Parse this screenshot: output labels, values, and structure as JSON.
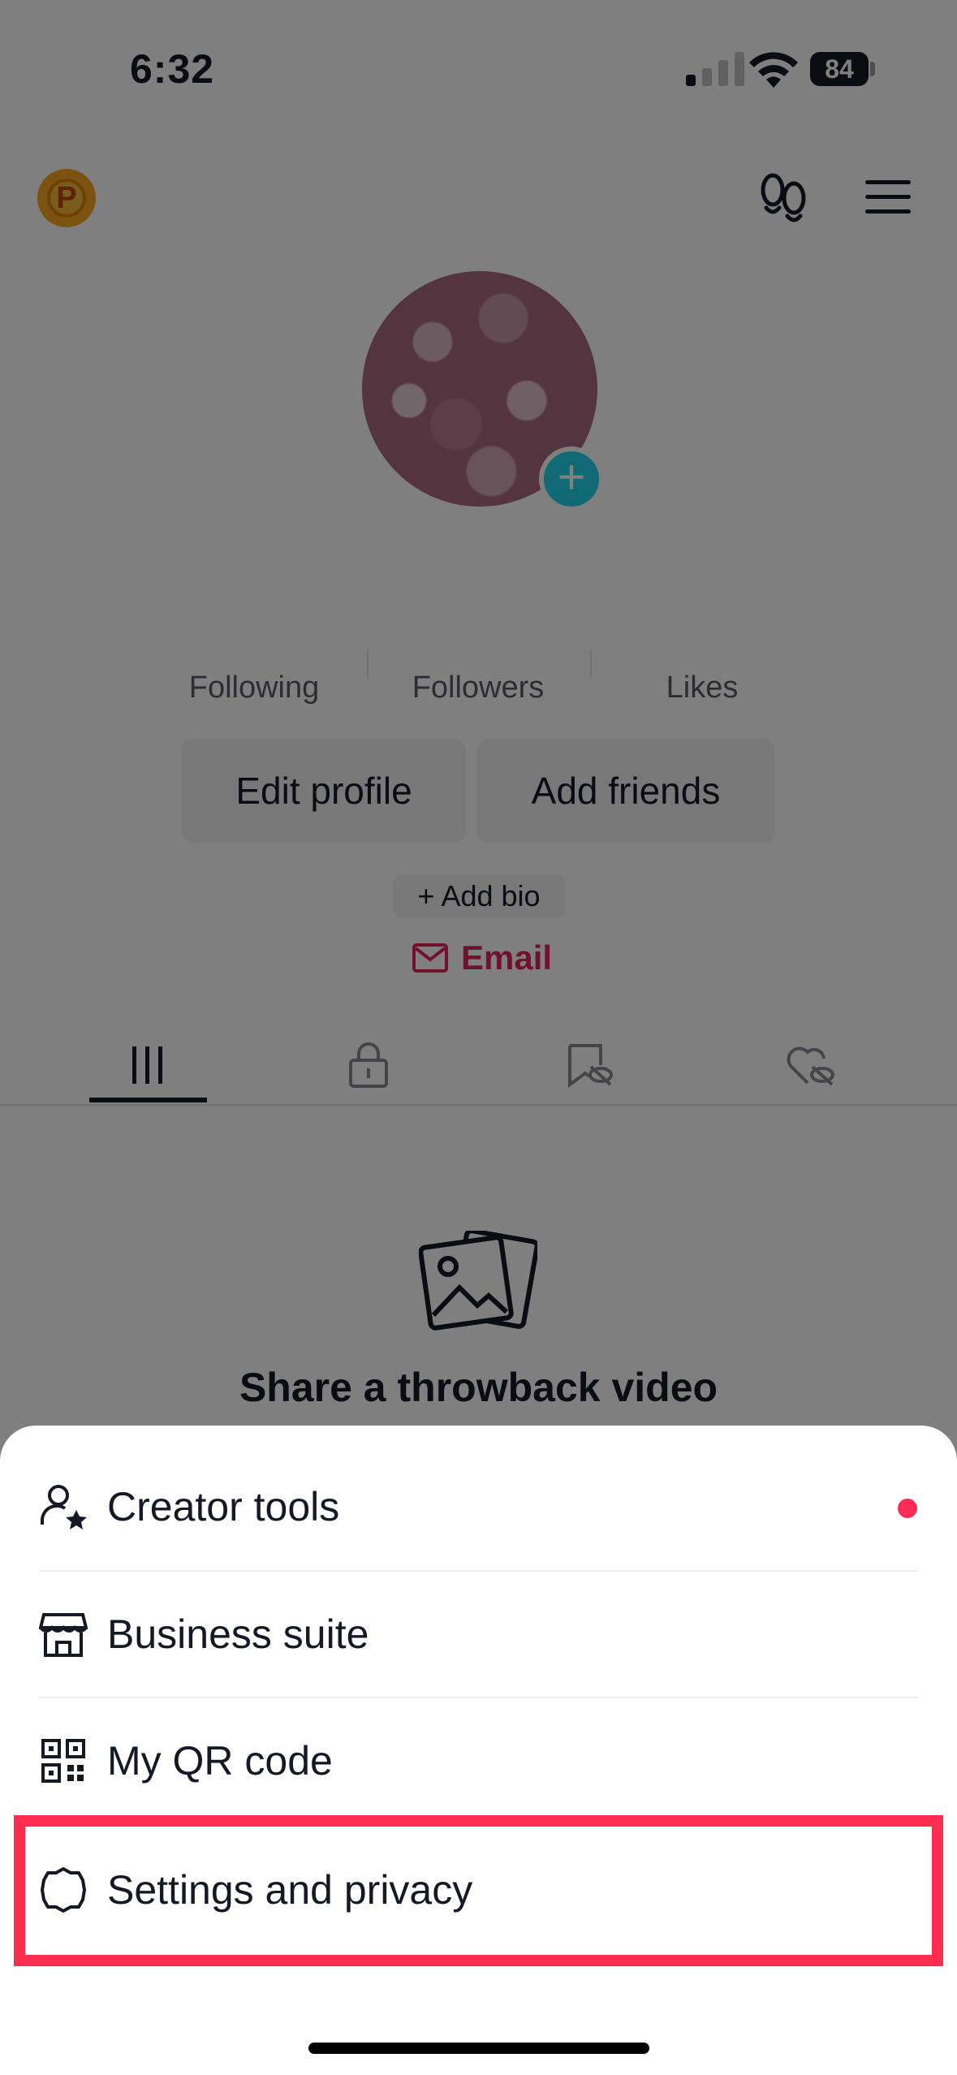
{
  "status_bar": {
    "time": "6:32",
    "battery": "84"
  },
  "profile": {
    "coin_letter": "P",
    "stats": [
      {
        "label": "Following"
      },
      {
        "label": "Followers"
      },
      {
        "label": "Likes"
      }
    ],
    "buttons": {
      "edit": "Edit profile",
      "add_friends": "Add friends"
    },
    "add_bio": "+ Add bio",
    "email": "Email",
    "avatar_plus": "+"
  },
  "empty_state": {
    "title": "Share a throwback video"
  },
  "menu": {
    "items": [
      {
        "label": "Creator tools",
        "icon": "person-star-icon"
      },
      {
        "label": "Business suite",
        "icon": "storefront-icon"
      },
      {
        "label": "My QR code",
        "icon": "qr-code-icon"
      },
      {
        "label": "Settings and privacy",
        "icon": "gear-icon"
      }
    ]
  },
  "colors": {
    "accent_red": "#fe2c55",
    "avatar_plus": "#20d5ec",
    "coin": "#f6a51f"
  }
}
